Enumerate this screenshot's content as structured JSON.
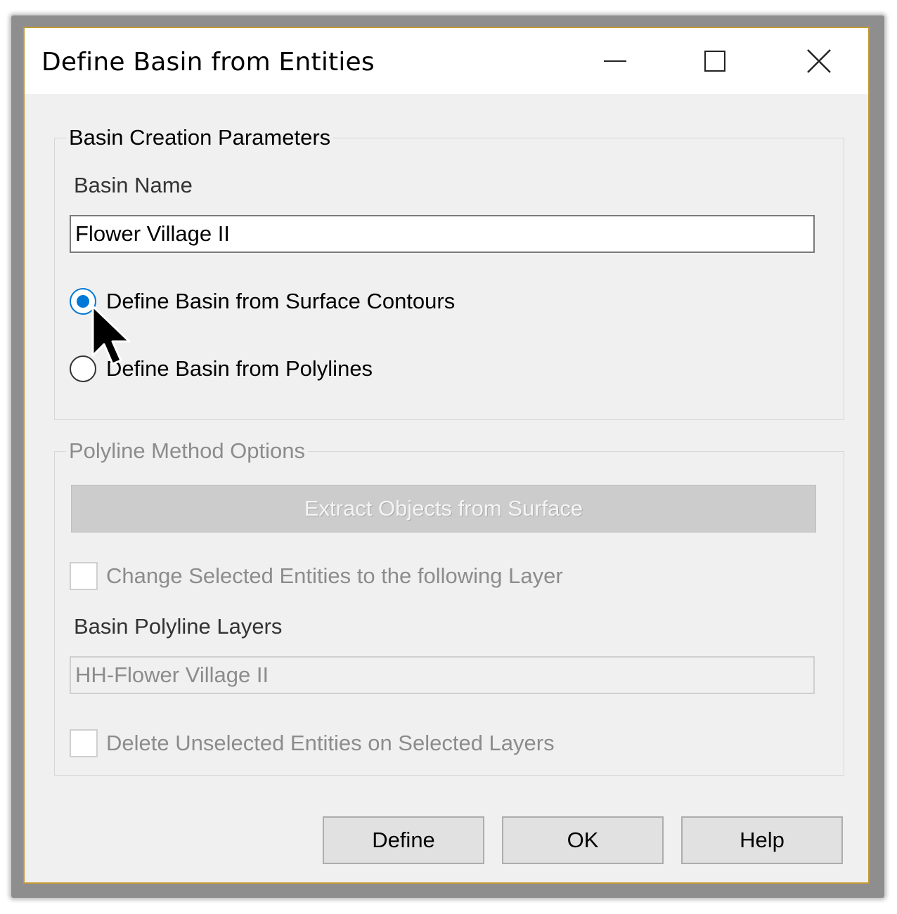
{
  "window": {
    "title": "Define Basin from Entities"
  },
  "basin_group": {
    "legend": "Basin Creation Parameters",
    "basin_name_label": "Basin Name",
    "basin_name_value": "Flower Village II",
    "radio_surface_contours": "Define Basin from Surface Contours",
    "radio_polylines": "Define Basin from Polylines",
    "selected_option": "Define Basin from Surface Contours"
  },
  "polyline_group": {
    "legend": "Polyline Method Options",
    "extract_button": "Extract Objects from Surface",
    "change_layer_checkbox": "Change Selected Entities to the following Layer",
    "layers_label": "Basin Polyline Layers",
    "layers_value": "HH-Flower Village II",
    "delete_unselected_checkbox": "Delete Unselected Entities on Selected  Layers"
  },
  "buttons": {
    "define": "Define",
    "ok": "OK",
    "help": "Help"
  },
  "colors": {
    "accent": "#0078d7",
    "window_border": "#c49a34",
    "disabled_text": "#8c8c8c"
  },
  "icons": [
    "minimize-icon",
    "maximize-icon",
    "close-icon",
    "mouse-cursor-icon"
  ]
}
